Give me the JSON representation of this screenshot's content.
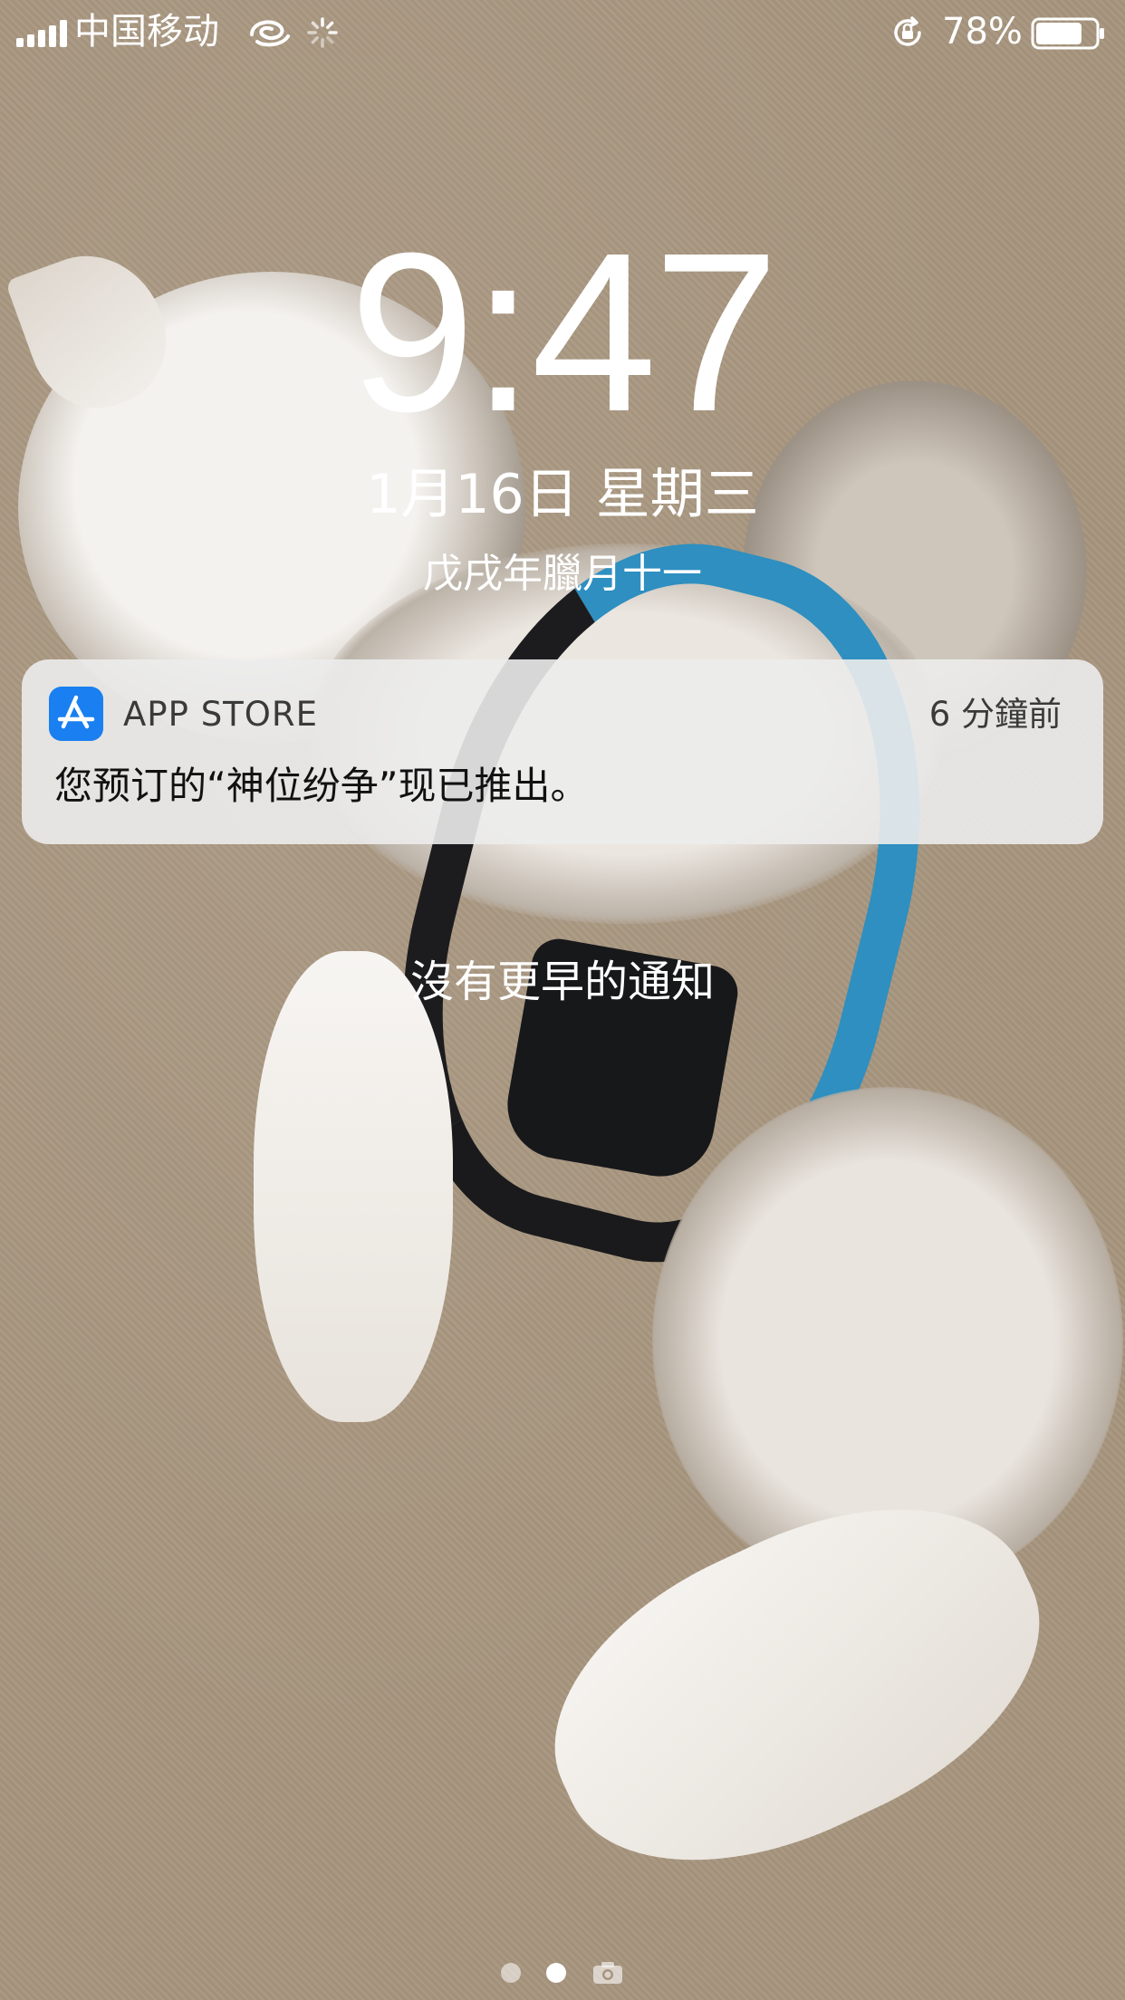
{
  "status_bar": {
    "carrier": "中国移动",
    "battery_percent": "78%",
    "battery_level": 0.78,
    "signal_bars": 5,
    "icons": [
      "signal-icon",
      "wifi-icon",
      "activity-spinner-icon",
      "orientation-lock-icon",
      "battery-icon"
    ]
  },
  "lockscreen": {
    "time": "9:47",
    "date": "1月16日 星期三",
    "lunar_date": "戊戌年臘月十一"
  },
  "notification": {
    "app_name": "APP STORE",
    "time_ago": "6 分鐘前",
    "message": "您预订的“神位纷争”现已推出。",
    "icon": "app-store-icon",
    "icon_color": "#1a7ff0"
  },
  "no_older_notifications": "沒有更早的通知",
  "page_indicator": {
    "pages": 2,
    "active_index": 1,
    "trailing_icon": "camera-icon"
  }
}
